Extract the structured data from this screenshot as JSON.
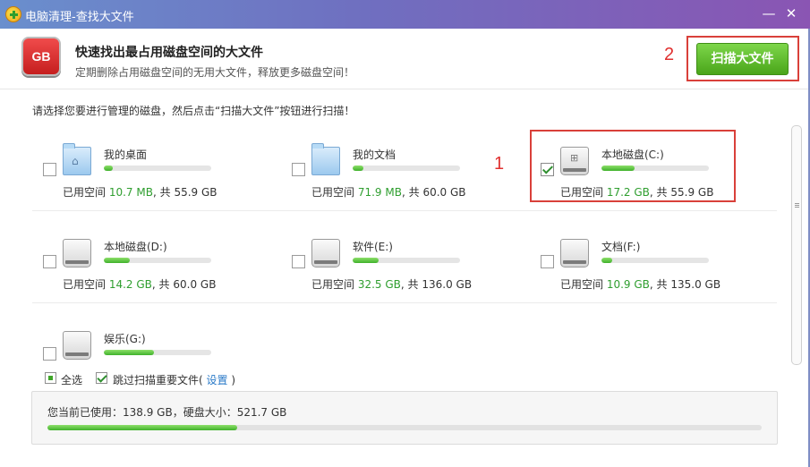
{
  "window": {
    "title": "电脑清理-查找大文件",
    "minimize": "—",
    "close": "✕"
  },
  "header": {
    "icon_text": "GB",
    "title": "快速找出最占用磁盘空间的大文件",
    "subtitle": "定期删除占用磁盘空间的无用大文件，释放更多磁盘空间！",
    "scan_button": "扫描大文件"
  },
  "annotations": {
    "step1": "1",
    "step2": "2"
  },
  "hint": "请选择您要进行管理的磁盘，然后点击“扫描大文件”按钮进行扫描！",
  "usage_label": "已用空间",
  "usage_sep": ", 共",
  "drives": [
    {
      "name": "我的桌面",
      "used": "10.7 MB",
      "total": "55.9 GB",
      "icon": "desktop-folder-icon",
      "checked": false,
      "fill": 0.08
    },
    {
      "name": "我的文档",
      "used": "71.9 MB",
      "total": "60.0 GB",
      "icon": "documents-folder-icon",
      "checked": false,
      "fill": 0.1
    },
    {
      "name": "本地磁盘(C:)",
      "used": "17.2 GB",
      "total": "55.9 GB",
      "icon": "windows-drive-icon",
      "checked": true,
      "fill": 0.31
    },
    {
      "name": "本地磁盘(D:)",
      "used": "14.2 GB",
      "total": "60.0 GB",
      "icon": "hard-drive-icon",
      "checked": false,
      "fill": 0.24
    },
    {
      "name": "软件(E:)",
      "used": "32.5 GB",
      "total": "136.0 GB",
      "icon": "hard-drive-icon",
      "checked": false,
      "fill": 0.24
    },
    {
      "name": "文档(F:)",
      "used": "10.9 GB",
      "total": "135.0 GB",
      "icon": "hard-drive-icon",
      "checked": false,
      "fill": 0.1
    },
    {
      "name": "娱乐(G:)",
      "used": "",
      "total": "",
      "icon": "hard-drive-icon",
      "checked": false,
      "fill": 0.47
    }
  ],
  "options": {
    "select_all": "全选",
    "skip_important": "跳过扫描重要文件(",
    "settings_link": "设置",
    "close_paren": ")"
  },
  "summary": {
    "text": "您当前已使用：138.9 GB，硬盘大小：521.7 GB",
    "fill": 0.266
  },
  "colors": {
    "accent_green": "#4aa51a",
    "annotation_red": "#d9403a",
    "title_bar": "#6f6fc0"
  }
}
